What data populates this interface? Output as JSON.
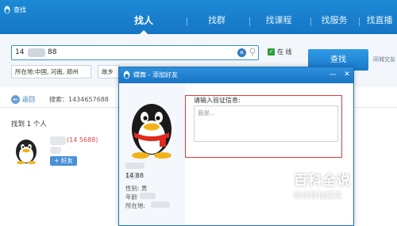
{
  "app": {
    "title": "查找"
  },
  "tabs": [
    {
      "label": "找人",
      "active": true
    },
    {
      "label": "找群",
      "active": false
    },
    {
      "label": "找课程",
      "active": false
    },
    {
      "label": "找服务",
      "active": false
    },
    {
      "label": "找直播",
      "active": false
    }
  ],
  "search": {
    "keyword_prefix": "14",
    "keyword_suffix": "88",
    "online_label": "在  线",
    "location_value": "所在地:中国, 河南, 郑州",
    "home_value": "故乡",
    "find_button": "查找",
    "same_city_hint": "同城交友"
  },
  "results": {
    "back_label": "返回",
    "query_text": "搜索：1434657688",
    "count_text": "找到 1 个人",
    "item_name_fragment": "(14    5688)",
    "add_friend_label": "+ 好友"
  },
  "dialog": {
    "title": "蝶舞 - 添加好友",
    "minimize_icon": "—",
    "close_icon": "✕",
    "id_fragment": "14    88",
    "gender": "性别: 男",
    "age": "年龄",
    "location": "所在地:",
    "verify_label": "请输入验证信息:",
    "verify_value": "我是..."
  },
  "watermark": {
    "title": "百科全说",
    "subtitle": "助你轻松解决"
  },
  "colors": {
    "brand": "#1c8ad6",
    "accent": "#e03a3a",
    "button": "#1979c9"
  }
}
